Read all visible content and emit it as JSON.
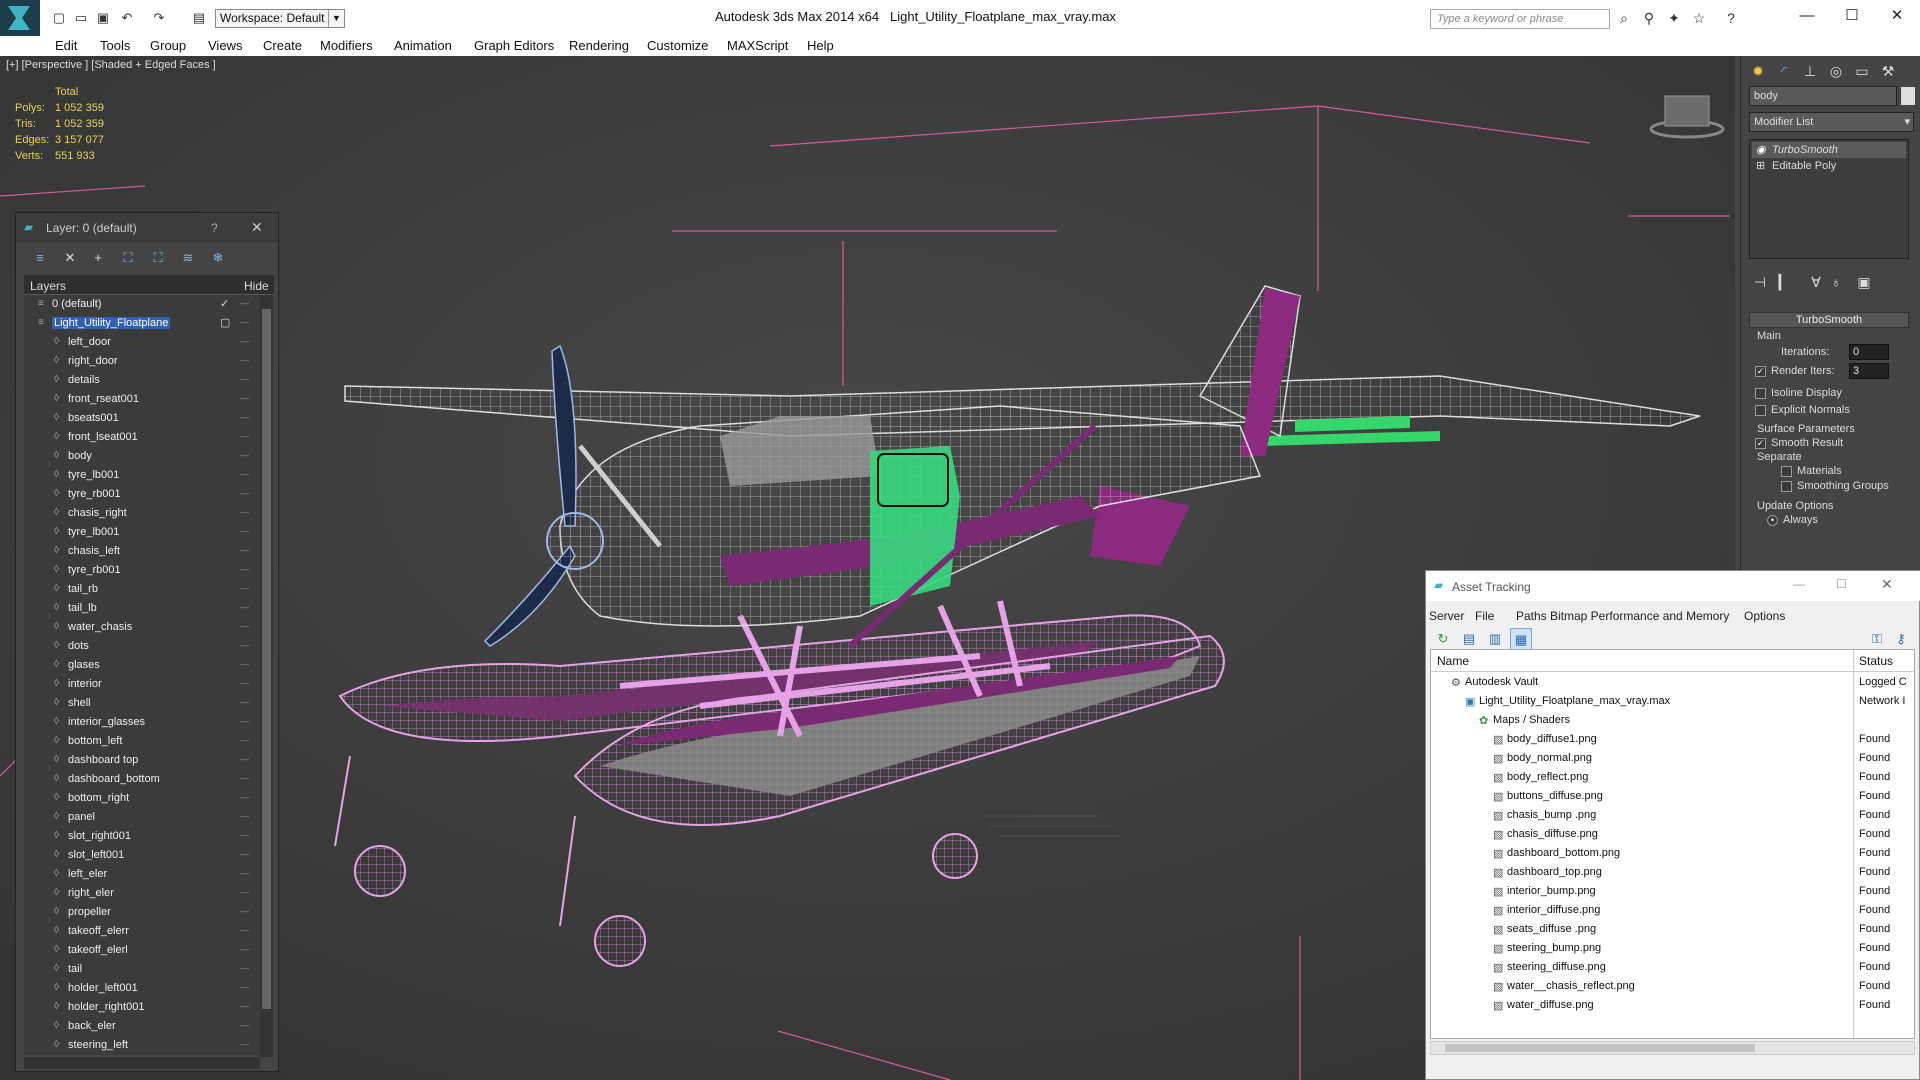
{
  "window": {
    "app_title": "Autodesk 3ds Max  2014 x64",
    "file_title": "Light_Utility_Floatplane_max_vray.max",
    "workspace": "Workspace: Default",
    "search_placeholder": "Type a keyword or phrase"
  },
  "menu": [
    "Edit",
    "Tools",
    "Group",
    "Views",
    "Create",
    "Modifiers",
    "Animation",
    "Graph Editors",
    "Rendering",
    "Customize",
    "MAXScript",
    "Help"
  ],
  "viewport": {
    "label": "[+] [Perspective ] [Shaded + Edged Faces ]",
    "stats": {
      "header": "Total",
      "rows": [
        {
          "label": "Polys:",
          "value": "1 052 359"
        },
        {
          "label": "Tris:",
          "value": "1 052 359"
        },
        {
          "label": "Edges:",
          "value": "3 157 077"
        },
        {
          "label": "Verts:",
          "value": "551 933"
        }
      ]
    }
  },
  "layer_panel": {
    "title": "Layer: 0 (default)",
    "help": "?",
    "col_layers": "Layers",
    "col_hide": "Hide",
    "layers": [
      {
        "name": "0 (default)",
        "kind": "layer"
      },
      {
        "name": "Light_Utility_Floatplane",
        "kind": "layer",
        "selected": true
      },
      {
        "name": "left_door"
      },
      {
        "name": "right_door"
      },
      {
        "name": "details"
      },
      {
        "name": "front_rseat001"
      },
      {
        "name": "bseats001"
      },
      {
        "name": "front_lseat001"
      },
      {
        "name": "body"
      },
      {
        "name": "tyre_lb001"
      },
      {
        "name": "tyre_rb001"
      },
      {
        "name": "chasis_right"
      },
      {
        "name": "tyre_lb001"
      },
      {
        "name": "chasis_left"
      },
      {
        "name": "tyre_rb001"
      },
      {
        "name": "tail_rb"
      },
      {
        "name": "tail_lb"
      },
      {
        "name": "water_chasis"
      },
      {
        "name": "dots"
      },
      {
        "name": "glases"
      },
      {
        "name": "interior"
      },
      {
        "name": "shell"
      },
      {
        "name": "interior_glasses"
      },
      {
        "name": "bottom_left"
      },
      {
        "name": "dashboard top"
      },
      {
        "name": "dashboard_bottom"
      },
      {
        "name": "bottom_right"
      },
      {
        "name": "panel"
      },
      {
        "name": "slot_right001"
      },
      {
        "name": "slot_left001"
      },
      {
        "name": "left_eler"
      },
      {
        "name": "right_eler"
      },
      {
        "name": "propeller"
      },
      {
        "name": "takeoff_elerr"
      },
      {
        "name": "takeoff_elerl"
      },
      {
        "name": "tail"
      },
      {
        "name": "holder_left001"
      },
      {
        "name": "holder_right001"
      },
      {
        "name": "back_eler"
      },
      {
        "name": "steering_left"
      }
    ]
  },
  "command_panel": {
    "object_name": "body",
    "modifier_list": "Modifier List",
    "stack": [
      "TurboSmooth",
      "Editable Poly"
    ],
    "rollout": "TurboSmooth",
    "main_label": "Main",
    "iterations_label": "Iterations:",
    "iterations_value": "0",
    "render_iters_label": "Render Iters:",
    "render_iters_value": "3",
    "isoline": "Isoline Display",
    "explicit": "Explicit Normals",
    "surface_params": "Surface Parameters",
    "smooth_result": "Smooth Result",
    "separate": "Separate",
    "materials": "Materials",
    "smoothing_groups": "Smoothing Groups",
    "update_options": "Update Options",
    "always": "Always"
  },
  "asset_tracking": {
    "title": "Asset Tracking",
    "menu": [
      "Server",
      "File",
      "Paths",
      "Bitmap Performance and Memory",
      "Options"
    ],
    "col_name": "Name",
    "col_status": "Status",
    "rows": [
      {
        "name": "Autodesk Vault",
        "status": "Logged C",
        "indent": 0
      },
      {
        "name": "Light_Utility_Floatplane_max_vray.max",
        "status": "Network I",
        "indent": 1
      },
      {
        "name": "Maps / Shaders",
        "status": "",
        "indent": 2
      },
      {
        "name": "body_diffuse1.png",
        "status": "Found",
        "indent": 3
      },
      {
        "name": "body_normal.png",
        "status": "Found",
        "indent": 3
      },
      {
        "name": "body_reflect.png",
        "status": "Found",
        "indent": 3
      },
      {
        "name": "buttons_diffuse.png",
        "status": "Found",
        "indent": 3
      },
      {
        "name": "chasis_bump .png",
        "status": "Found",
        "indent": 3
      },
      {
        "name": "chasis_diffuse.png",
        "status": "Found",
        "indent": 3
      },
      {
        "name": "dashboard_bottom.png",
        "status": "Found",
        "indent": 3
      },
      {
        "name": "dashboard_top.png",
        "status": "Found",
        "indent": 3
      },
      {
        "name": "interior_bump.png",
        "status": "Found",
        "indent": 3
      },
      {
        "name": "interior_diffuse.png",
        "status": "Found",
        "indent": 3
      },
      {
        "name": "seats_diffuse .png",
        "status": "Found",
        "indent": 3
      },
      {
        "name": "steering_bump.png",
        "status": "Found",
        "indent": 3
      },
      {
        "name": "steering_diffuse.png",
        "status": "Found",
        "indent": 3
      },
      {
        "name": "water__chasis_reflect.png",
        "status": "Found",
        "indent": 3
      },
      {
        "name": "water_diffuse.png",
        "status": "Found",
        "indent": 3
      }
    ]
  }
}
